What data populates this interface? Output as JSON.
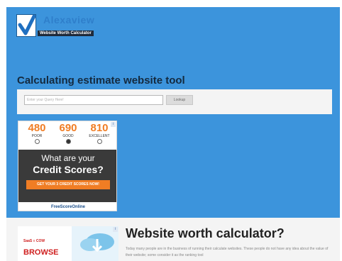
{
  "header": {
    "brand": "Alexaview",
    "tagline": "Website Worth Calculator"
  },
  "tool": {
    "heading": "Calculating estimate website tool",
    "input_placeholder": "Enter your Query Here!",
    "button_label": "Lookup"
  },
  "credit_ad": {
    "badge": "i",
    "scores": [
      {
        "value": "480",
        "label": "POOR",
        "selected": false
      },
      {
        "value": "690",
        "label": "GOOD",
        "selected": true
      },
      {
        "value": "810",
        "label": "EXCELLENT",
        "selected": false
      }
    ],
    "question_line1": "What are your",
    "question_line2": "Credit Scores?",
    "cta": "GET YOUR 3 CREDIT SCORES NOW!",
    "footer": "FreeScoreOnline"
  },
  "bottom_ad": {
    "badge": "i",
    "brand": "SaaS ≡ COW",
    "cta": "BROWSE"
  },
  "article": {
    "title": "Website worth calculator?",
    "description": "Today many people are in the business of running their calculate websites. These people do not have any idea about the value of their website; some consider it as the ranking tool"
  },
  "colors": {
    "hero_bg": "#3c94dc",
    "accent_orange": "#f07d24",
    "ad_red": "#cf1f1f"
  }
}
